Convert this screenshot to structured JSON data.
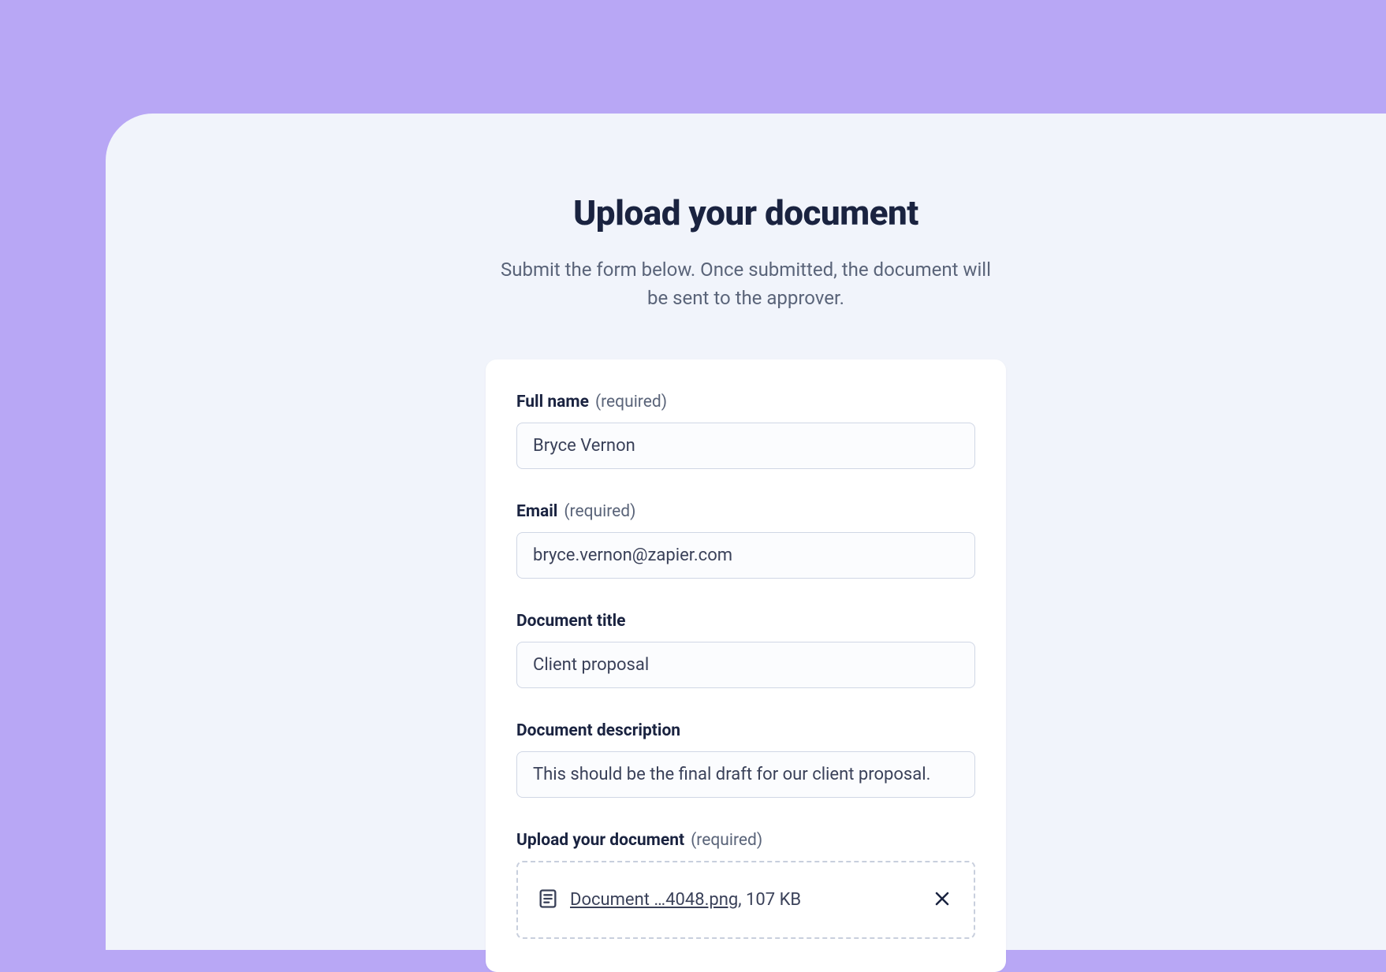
{
  "header": {
    "title": "Upload your document",
    "subtitle": "Submit the form below. Once submitted, the document will be sent to the approver."
  },
  "form": {
    "requiredText": "(required)",
    "fullName": {
      "label": "Full name",
      "required": true,
      "value": "Bryce Vernon"
    },
    "email": {
      "label": "Email",
      "required": true,
      "value": "bryce.vernon@zapier.com"
    },
    "documentTitle": {
      "label": "Document title",
      "required": false,
      "value": "Client proposal"
    },
    "documentDescription": {
      "label": "Document description",
      "required": false,
      "value": "This should be the final draft for our client proposal."
    },
    "upload": {
      "label": "Upload your document",
      "required": true,
      "file": {
        "name": "Document …4048.png",
        "separator": ", ",
        "size": "107 KB"
      }
    }
  }
}
